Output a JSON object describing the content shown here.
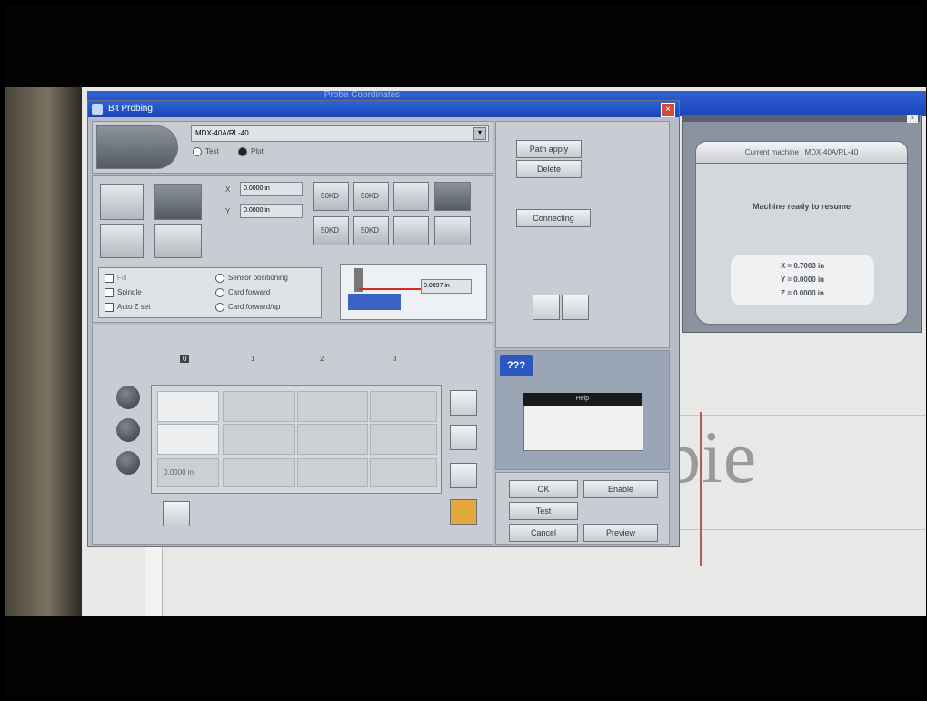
{
  "window": {
    "title": "Bit Probing",
    "bg_title": "— Probe Coordinates ——"
  },
  "top": {
    "machine_combo": "MDX-40A/RL-40",
    "radio_test": "Test",
    "radio_plot": "Plot"
  },
  "buttons": {
    "path_apply": "Path apply",
    "delete": "Delete",
    "connecting": "Connecting",
    "ok": "OK",
    "enable": "Enable",
    "test": "Test",
    "cancel": "Cancel",
    "preview": "Preview"
  },
  "options": {
    "fill_label": "Fill",
    "spindle": "Spindle",
    "auto_z_set": "Auto Z set",
    "sensor_label_1": "Sensor positioning",
    "sensor_label_2": "Card forward",
    "sensor_label_3": "Card forward/up"
  },
  "fields": {
    "x_value": "0.0000 in",
    "y_value": "0.0000 in",
    "depth_value": "0.0097 in",
    "grid_depth_value": "0.0000 in"
  },
  "labels": {
    "x_axis": "X",
    "y_axis": "Y"
  },
  "grid_headers": {
    "h0": "0",
    "h1": "1",
    "h2": "2",
    "h3": "3"
  },
  "tiles": {
    "t1": "50KD",
    "t2": "50KD",
    "t3": "50KD",
    "t4": "50KD"
  },
  "help": {
    "title": "???",
    "panel_caption": "Help"
  },
  "machine_panel": {
    "header": "Current machine : MDX-40A/RL-40",
    "status": "Machine ready to resume",
    "x": "X = 0.7003 in",
    "y": "Y = 0.0000 in",
    "z": "Z = 0.0000 in"
  },
  "document": {
    "word": "bie"
  }
}
